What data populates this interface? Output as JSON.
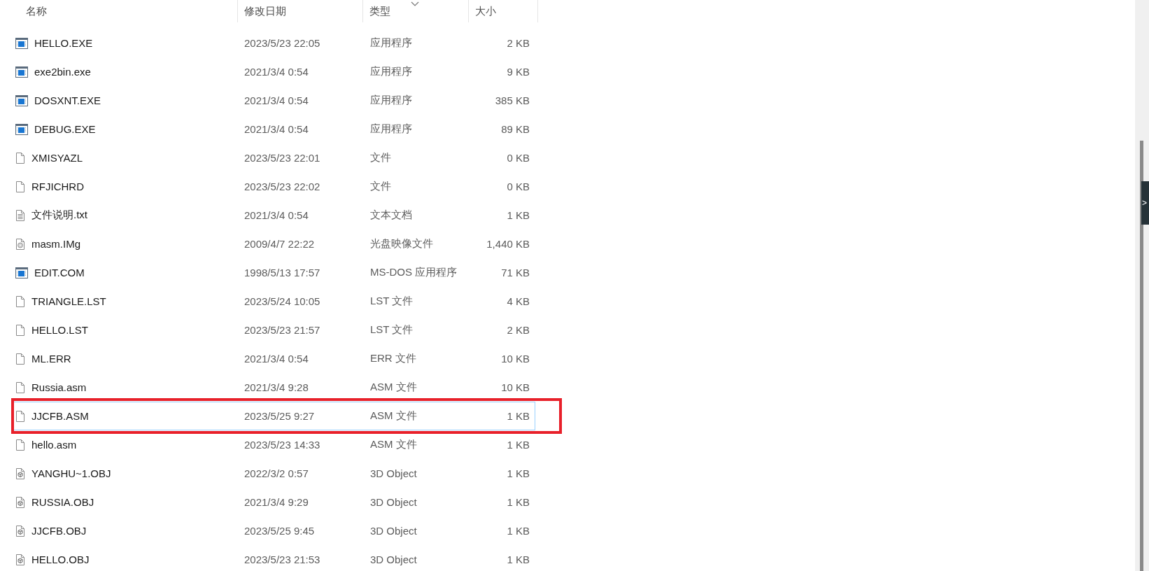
{
  "columns": [
    {
      "label": "名称"
    },
    {
      "label": "修改日期"
    },
    {
      "label": "类型",
      "sorted": true
    },
    {
      "label": "大小"
    }
  ],
  "rows": [
    {
      "name": "HELLO.EXE",
      "date": "2023/5/23 22:05",
      "type": "应用程序",
      "size": "2 KB",
      "kind": "app",
      "selected": false
    },
    {
      "name": "exe2bin.exe",
      "date": "2021/3/4 0:54",
      "type": "应用程序",
      "size": "9 KB",
      "kind": "app",
      "selected": false
    },
    {
      "name": "DOSXNT.EXE",
      "date": "2021/3/4 0:54",
      "type": "应用程序",
      "size": "385 KB",
      "kind": "app",
      "selected": false
    },
    {
      "name": "DEBUG.EXE",
      "date": "2021/3/4 0:54",
      "type": "应用程序",
      "size": "89 KB",
      "kind": "app",
      "selected": false
    },
    {
      "name": "XMISYAZL",
      "date": "2023/5/23 22:01",
      "type": "文件",
      "size": "0 KB",
      "kind": "file",
      "selected": false
    },
    {
      "name": "RFJICHRD",
      "date": "2023/5/23 22:02",
      "type": "文件",
      "size": "0 KB",
      "kind": "file",
      "selected": false
    },
    {
      "name": "文件说明.txt",
      "date": "2021/3/4 0:54",
      "type": "文本文档",
      "size": "1 KB",
      "kind": "text",
      "selected": false
    },
    {
      "name": "masm.IMg",
      "date": "2009/4/7 22:22",
      "type": "光盘映像文件",
      "size": "1,440 KB",
      "kind": "disc",
      "selected": false
    },
    {
      "name": "EDIT.COM",
      "date": "1998/5/13 17:57",
      "type": "MS-DOS 应用程序",
      "size": "71 KB",
      "kind": "app",
      "selected": false
    },
    {
      "name": "TRIANGLE.LST",
      "date": "2023/5/24 10:05",
      "type": "LST 文件",
      "size": "4 KB",
      "kind": "file",
      "selected": false
    },
    {
      "name": "HELLO.LST",
      "date": "2023/5/23 21:57",
      "type": "LST 文件",
      "size": "2 KB",
      "kind": "file",
      "selected": false
    },
    {
      "name": "ML.ERR",
      "date": "2021/3/4 0:54",
      "type": "ERR 文件",
      "size": "10 KB",
      "kind": "file",
      "selected": false
    },
    {
      "name": "Russia.asm",
      "date": "2021/3/4 9:28",
      "type": "ASM 文件",
      "size": "10 KB",
      "kind": "file",
      "selected": false
    },
    {
      "name": "JJCFB.ASM",
      "date": "2023/5/25 9:27",
      "type": "ASM 文件",
      "size": "1 KB",
      "kind": "file",
      "selected": true,
      "annotated": true
    },
    {
      "name": "hello.asm",
      "date": "2023/5/23 14:33",
      "type": "ASM 文件",
      "size": "1 KB",
      "kind": "file",
      "selected": false
    },
    {
      "name": "YANGHU~1.OBJ",
      "date": "2022/3/2 0:57",
      "type": "3D Object",
      "size": "1 KB",
      "kind": "object3d",
      "selected": false
    },
    {
      "name": "RUSSIA.OBJ",
      "date": "2021/3/4 9:29",
      "type": "3D Object",
      "size": "1 KB",
      "kind": "object3d",
      "selected": false
    },
    {
      "name": "JJCFB.OBJ",
      "date": "2023/5/25 9:45",
      "type": "3D Object",
      "size": "1 KB",
      "kind": "object3d",
      "selected": false
    },
    {
      "name": "HELLO.OBJ",
      "date": "2023/5/23 21:53",
      "type": "3D Object",
      "size": "1 KB",
      "kind": "object3d",
      "selected": false
    }
  ],
  "side_tab": {
    "label": ">"
  }
}
